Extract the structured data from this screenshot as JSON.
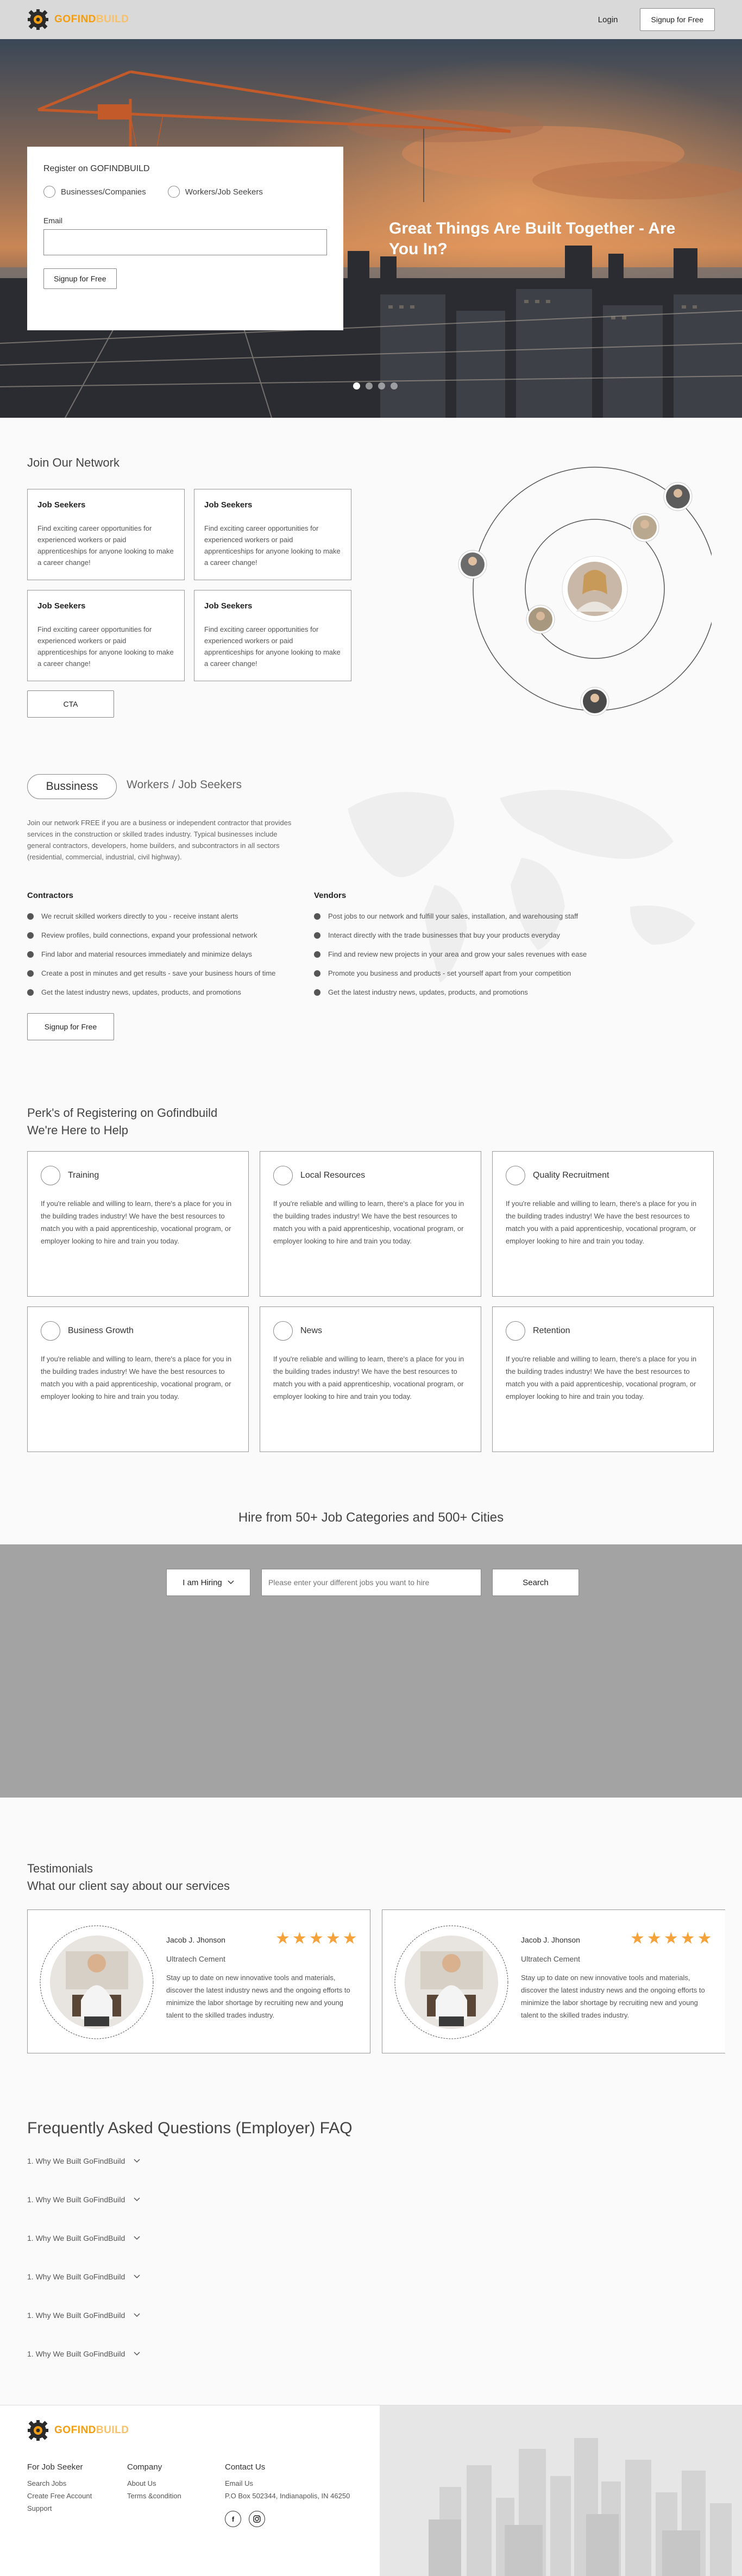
{
  "header": {
    "logo": {
      "go": "GO",
      "find": "FIND",
      "build": "BUILD"
    },
    "login_label": "Login",
    "signup_label": "Signup for Free"
  },
  "hero": {
    "register_title": "Register on GOFINDBUILD",
    "radio_options": [
      "Businesses/Companies",
      "Workers/Job Seekers"
    ],
    "email_label": "Email",
    "signup_label": "Signup for Free",
    "headline": "Great Things Are Built Together - Are You In?",
    "active_slide": 1,
    "slide_count": 4
  },
  "network": {
    "title": "Join Our Network",
    "cards": [
      {
        "title": "Job Seekers",
        "text": "Find exciting career opportunities for experienced workers or paid apprenticeships for anyone looking to make a career change!"
      },
      {
        "title": "Job Seekers",
        "text": "Find exciting career opportunities for experienced workers or paid apprenticeships for anyone looking to make a career change!"
      },
      {
        "title": "Job Seekers",
        "text": "Find exciting career opportunities for experienced workers or paid apprenticeships for anyone looking to make a career change!"
      },
      {
        "title": "Job Seekers",
        "text": "Find exciting career opportunities for experienced workers or paid apprenticeships for anyone looking to make a career change!"
      }
    ],
    "cta_label": "CTA"
  },
  "business": {
    "tab_active": "Bussiness",
    "tab_other": "Workers / Job Seekers",
    "intro": "Join our network FREE if you are a business or independent contractor that provides services in the construction or skilled trades industry. Typical businesses include general contractors, developers, home builders, and subcontractors in all sectors (residential, commercial, industrial, civil highway).",
    "contractors_title": "Contractors",
    "contractors": [
      "We recruit skilled workers directly to you - receive instant alerts",
      "Review profiles, build connections, expand your professional network",
      "Find labor and material resources immediately and minimize delays",
      "Create a post in minutes and get results - save your business hours of time",
      "Get the latest industry news, updates, products, and promotions"
    ],
    "vendors_title": "Vendors",
    "vendors": [
      "Post jobs to our network and fulfill your sales, installation, and warehousing staff",
      "Interact directly with the trade businesses that buy your products everyday",
      "Find and review new projects in your area and grow your sales revenues with ease",
      "Promote you business and products - set yourself apart from your competition",
      "Get the latest industry news, updates, products, and promotions"
    ],
    "signup_label": "Signup for Free"
  },
  "perks": {
    "title_line1": "Perk's of Registering on Gofindbuild",
    "title_line2": "We're Here to Help",
    "items": [
      {
        "name": "Training",
        "text": "If you're reliable and willing to learn, there's a place for you in the building trades industry! We have the best resources to match you with a paid apprenticeship, vocational program, or employer looking to hire and train you today."
      },
      {
        "name": "Local Resources",
        "text": "If you're reliable and willing to learn, there's a place for you in the building trades industry! We have the best resources to match you with a paid apprenticeship, vocational program, or employer looking to hire and train you today."
      },
      {
        "name": "Quality Recruitment",
        "text": "If you're reliable and willing to learn, there's a place for you in the building trades industry! We have the best resources to match you with a paid apprenticeship, vocational program, or employer looking to hire and train you today."
      },
      {
        "name": "Business Growth",
        "text": "If you're reliable and willing to learn, there's a place for you in the building trades industry! We have the best resources to match you with a paid apprenticeship, vocational program, or employer looking to hire and train you today."
      },
      {
        "name": "News",
        "text": "If you're reliable and willing to learn, there's a place for you in the building trades industry! We have the best resources to match you with a paid apprenticeship, vocational program, or employer looking to hire and train you today."
      },
      {
        "name": "Retention",
        "text": "If you're reliable and willing to learn, there's a place for you in the building trades industry! We have the best resources to match you with a paid apprenticeship, vocational program, or employer looking to hire and train you today."
      }
    ]
  },
  "hire": {
    "title": "Hire from 50+ Job Categories and 500+ Cities",
    "select_label": "I am Hiring",
    "input_placeholder": "Please enter your different jobs you want to hire",
    "search_label": "Search"
  },
  "testimonials": {
    "title": "Testimonials",
    "subtitle": "What our client say about our services",
    "items": [
      {
        "name": "Jacob J. Jhonson",
        "role": "Ultratech Cement",
        "rating": 5,
        "text": "Stay up to date on new innovative tools and materials, discover the latest industry news and the ongoing efforts to minimize the labor shortage by recruiting new and young talent to the skilled trades industry."
      },
      {
        "name": "Jacob J. Jhonson",
        "role": "Ultratech Cement",
        "rating": 5,
        "text": "Stay up to date on new innovative tools and materials, discover the latest industry news and the ongoing efforts to minimize the labor shortage by recruiting new and young talent to the skilled trades industry."
      }
    ]
  },
  "faq": {
    "title": "Frequently Asked Questions (Employer) FAQ",
    "items": [
      "1. Why We Built GoFindBuild",
      "1. Why We Built GoFindBuild",
      "1. Why We Built GoFindBuild",
      "1. Why We Built GoFindBuild",
      "1. Why We Built GoFindBuild",
      "1. Why We Built GoFindBuild"
    ]
  },
  "footer": {
    "job_seeker_title": "For Job Seeker",
    "job_seeker_links": [
      "Search Jobs",
      "Create Free Account",
      "Support"
    ],
    "company_title": "Company",
    "company_links": [
      "About Us",
      "Terms &condition"
    ],
    "contact_title": "Contact Us",
    "contact_email": "Email Us",
    "contact_address": "P.O Box 502344, Indianapolis, IN 46250",
    "social": [
      "f",
      "ig"
    ]
  },
  "colors": {
    "brand_orange": "#f29d12",
    "star": "#f6a23a",
    "hire_band": "#a3a3a3"
  }
}
